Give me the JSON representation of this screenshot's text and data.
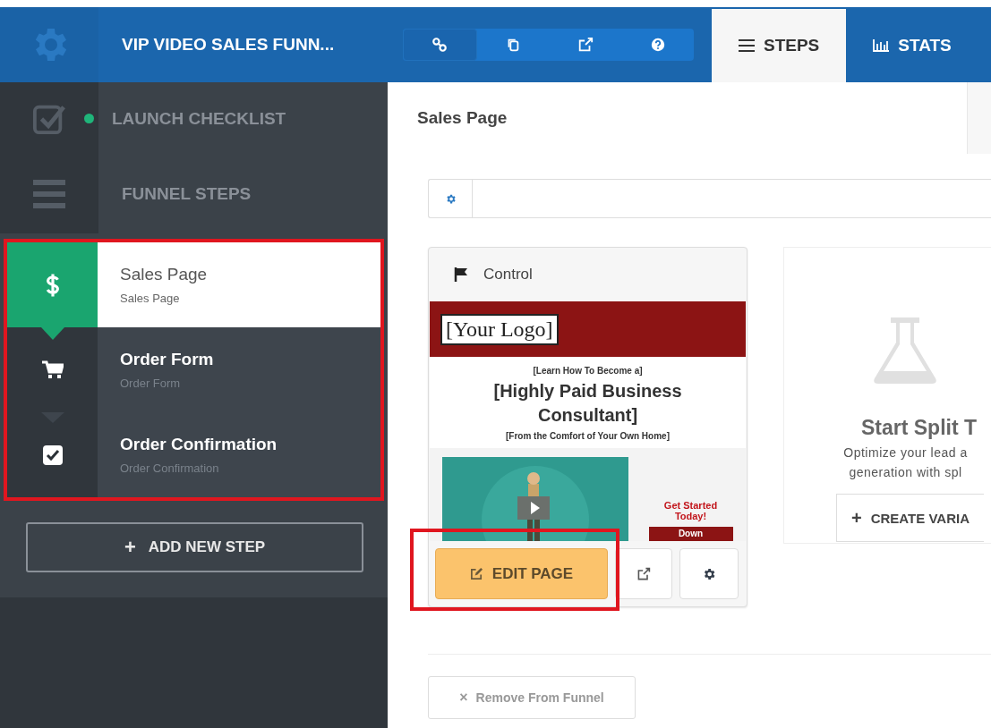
{
  "top_bar": {
    "funnel_title": "VIP VIDEO SALES FUNN...",
    "tools": [
      {
        "kind": "link"
      },
      {
        "kind": "copy"
      },
      {
        "kind": "external"
      },
      {
        "kind": "help"
      }
    ],
    "tabs": [
      {
        "label": "STEPS",
        "kind": "menu",
        "selected": true
      },
      {
        "label": "STATS",
        "kind": "chart",
        "selected": false
      }
    ]
  },
  "sidebar": {
    "sections": [
      {
        "label": "LAUNCH CHECKLIST",
        "kind": "checklist",
        "color": "#1fb57a"
      },
      {
        "label": "FUNNEL STEPS",
        "kind": "steps"
      }
    ],
    "steps": [
      {
        "title": "Sales Page",
        "subtitle": "Sales Page",
        "kind": "sales",
        "selected": true
      },
      {
        "title": "Order Form",
        "subtitle": "Order Form",
        "kind": "cart",
        "selected": false
      },
      {
        "title": "Order Confirmation",
        "subtitle": "Order Confirmation",
        "kind": "check",
        "selected": false
      }
    ],
    "add_button": {
      "icon": "+",
      "label": "ADD NEW STEP"
    }
  },
  "main": {
    "page_title": "Sales Page",
    "variant": {
      "label": "Control",
      "preview": {
        "logo": "[Your Logo]",
        "kicker": "[Learn How To Become a]",
        "headline": "[Highly Paid Business Consultant]",
        "subline": "[From the Comfort of Your Own Home]",
        "cta": "Get Started Today!",
        "button": "Down"
      },
      "edit_button": "EDIT PAGE"
    },
    "split_test": {
      "title": "Start Split T",
      "lines": [
        "Optimize your lead a",
        "generation with spl"
      ],
      "button": {
        "icon": "+",
        "label": "CREATE VARIA"
      }
    },
    "remove_button": {
      "icon": "×",
      "label": "Remove From Funnel"
    }
  }
}
